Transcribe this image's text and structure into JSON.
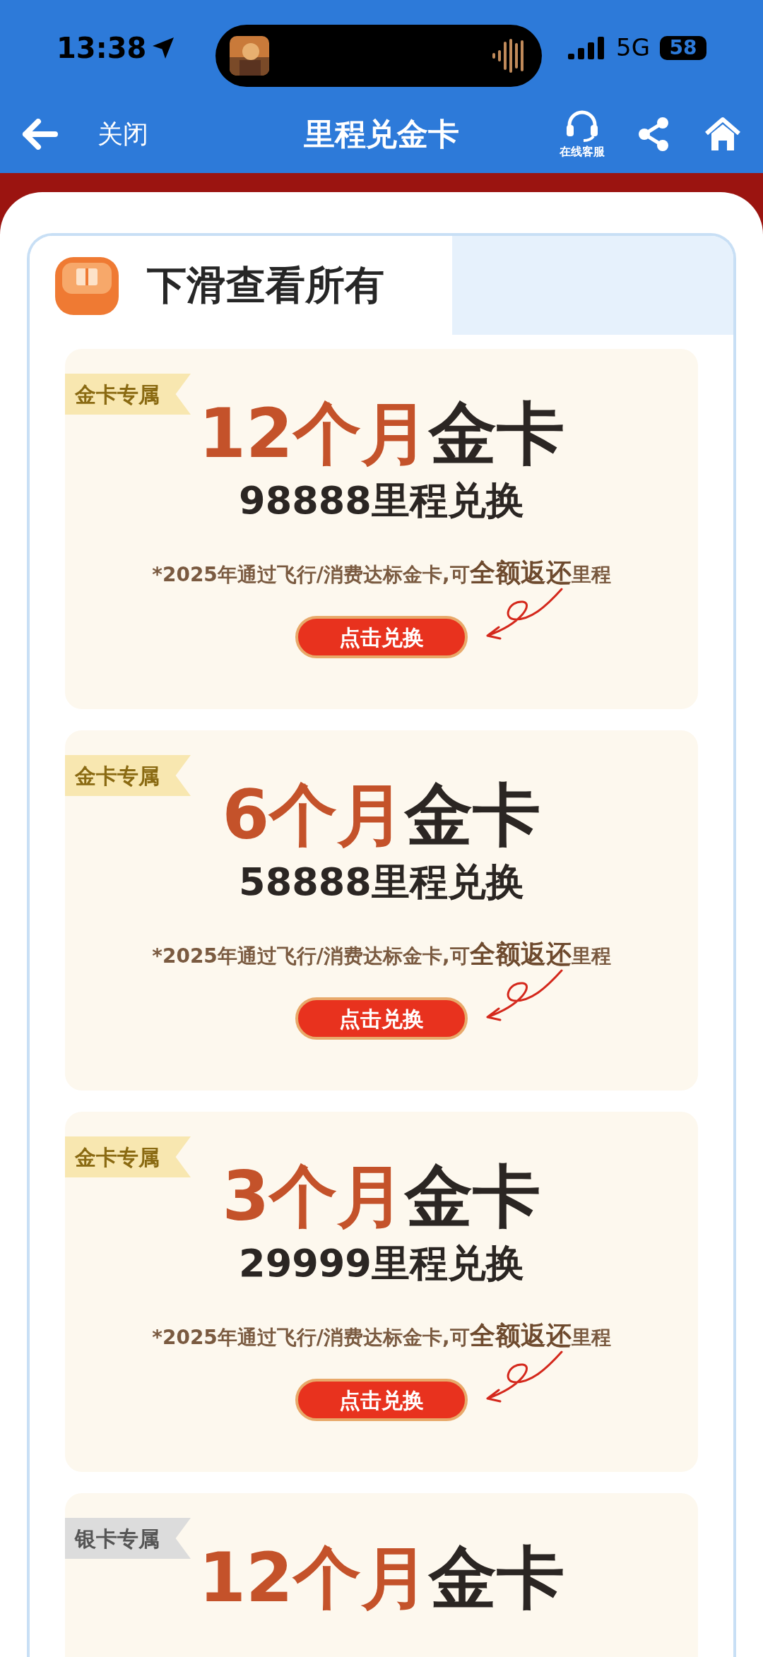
{
  "status_bar": {
    "time": "13:38",
    "network": "5G",
    "battery": "58"
  },
  "nav": {
    "close": "关闭",
    "title": "里程兑金卡",
    "service": "在线客服"
  },
  "section": {
    "title": "下滑查看所有"
  },
  "cards": [
    {
      "badge": {
        "text": "金卡专属",
        "kind": "gold"
      },
      "title_highlight": "12个月",
      "title_rest": "金卡",
      "price": "98888里程兑换",
      "note": "*2025年通过飞行/消费达标金卡,可**全额返还**里程",
      "button": "点击兑换"
    },
    {
      "badge": {
        "text": "金卡专属",
        "kind": "gold"
      },
      "title_highlight": "6个月",
      "title_rest": "金卡",
      "price": "58888里程兑换",
      "note": "*2025年通过飞行/消费达标金卡,可**全额返还**里程",
      "button": "点击兑换"
    },
    {
      "badge": {
        "text": "金卡专属",
        "kind": "gold"
      },
      "title_highlight": "3个月",
      "title_rest": "金卡",
      "price": "29999里程兑换",
      "note": "*2025年通过飞行/消费达标金卡,可**全额返还**里程",
      "button": "点击兑换"
    },
    {
      "badge": {
        "text": "银卡专属",
        "kind": "silver"
      },
      "title_highlight": "12个月",
      "title_rest": "金卡"
    }
  ]
}
